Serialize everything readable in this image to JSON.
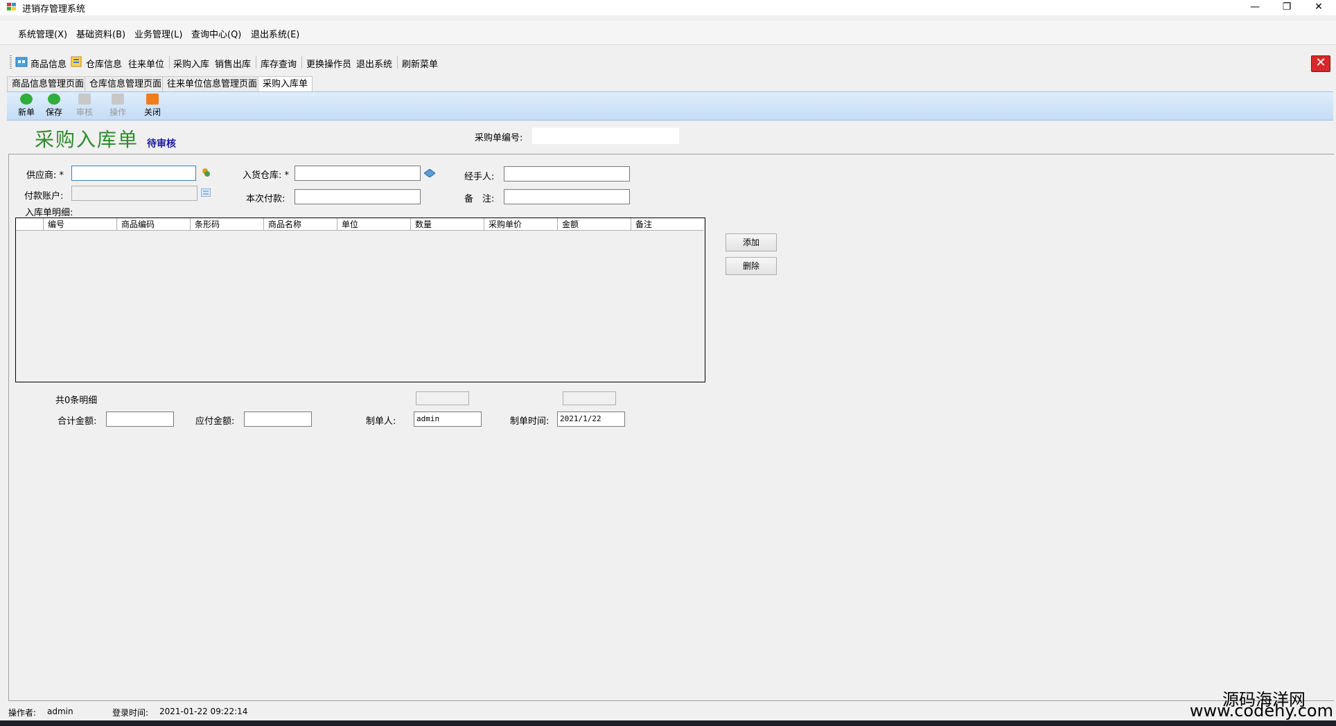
{
  "window": {
    "title": "进销存管理系统",
    "minimize": "—",
    "restore": "❐",
    "close": "✕"
  },
  "menu": [
    "系统管理(X)",
    "基础资料(B)",
    "业务管理(L)",
    "查询中心(Q)",
    "退出系统(E)"
  ],
  "toolbar": {
    "items": [
      "商品信息",
      "仓库信息",
      "往来单位",
      "采购入库",
      "销售出库",
      "库存查询",
      "更换操作员",
      "退出系统",
      "刷新菜单"
    ],
    "close_glyph": "✕"
  },
  "tabs": [
    "商品信息管理页面",
    "仓库信息管理页面",
    "往来单位信息管理页面",
    "采购入库单"
  ],
  "actions": [
    "新单",
    "保存",
    "审核",
    "操作",
    "关闭"
  ],
  "form": {
    "title": "采购入库单",
    "status": "待审核",
    "order_no_label": "采购单编号:",
    "supplier_label": "供应商:",
    "required_mark": "*",
    "warehouse_label": "入货仓库:",
    "handler_label": "经手人:",
    "account_label": "付款账户:",
    "payment_label": "本次付款:",
    "remark_label": "备　注:",
    "detail_label": "入库单明细:"
  },
  "grid": {
    "columns": [
      "编号",
      "商品编码",
      "条形码",
      "商品名称",
      "单位",
      "数量",
      "采购单价",
      "金额",
      "备注"
    ],
    "rows": []
  },
  "side_buttons": {
    "add": "添加",
    "delete": "删除"
  },
  "summary": {
    "count_text": "共0条明细",
    "total_label": "合计金额:",
    "payable_label": "应付金额:",
    "creator_label": "制单人:",
    "creator_value": "admin",
    "time_label": "制单时间:",
    "time_value": "2021/1/22"
  },
  "statusbar": {
    "operator_label": "操作者:",
    "operator_value": "admin",
    "login_label": "登录时间:",
    "login_value": "2021-01-22 09:22:14"
  },
  "watermark": {
    "line1": "源码海洋网",
    "line2": "www.codehy.com"
  }
}
